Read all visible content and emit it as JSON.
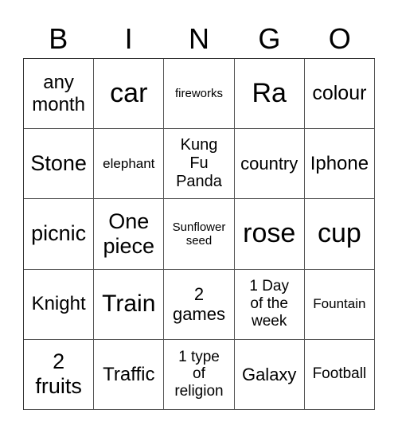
{
  "header": [
    "B",
    "I",
    "N",
    "G",
    "O"
  ],
  "cells": [
    [
      "any month",
      "car",
      "fireworks",
      "Ra",
      "colour"
    ],
    [
      "Stone",
      "elephant",
      "Kung Fu Panda",
      "country",
      "Iphone"
    ],
    [
      "picnic",
      "One piece",
      "Sunflower seed",
      "rose",
      "cup"
    ],
    [
      "Knight",
      "Train",
      "2 games",
      "1 Day of the week",
      "Fountain"
    ],
    [
      "2 fruits",
      "Traffic",
      "1 type of religion",
      "Galaxy",
      "Football"
    ]
  ]
}
